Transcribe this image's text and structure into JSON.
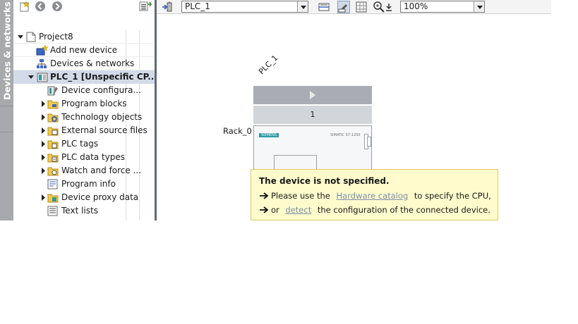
{
  "side_tab": {
    "label": "Devices & networks"
  },
  "project_tree": {
    "items": [
      {
        "label": "Project8",
        "icon": "project-icon",
        "expander": "open"
      },
      {
        "label": "Add new device",
        "icon": "add-device-icon",
        "expander": "none"
      },
      {
        "label": "Devices & networks",
        "icon": "network-icon",
        "expander": "none"
      },
      {
        "label": "PLC_1 [Unspecific CP...",
        "icon": "plc-icon",
        "expander": "open",
        "selected": true
      },
      {
        "label": "Device configura...",
        "icon": "device-config-icon",
        "expander": "none"
      },
      {
        "label": "Program blocks",
        "icon": "folder-icon",
        "expander": "closed"
      },
      {
        "label": "Technology objects",
        "icon": "technology-folder-icon",
        "expander": "closed"
      },
      {
        "label": "External source files",
        "icon": "source-folder-icon",
        "expander": "closed"
      },
      {
        "label": "PLC tags",
        "icon": "tags-folder-icon",
        "expander": "closed"
      },
      {
        "label": "PLC data types",
        "icon": "datatypes-folder-icon",
        "expander": "closed"
      },
      {
        "label": "Watch and force ...",
        "icon": "watch-folder-icon",
        "expander": "closed"
      },
      {
        "label": "Program info",
        "icon": "program-info-icon",
        "expander": "none"
      },
      {
        "label": "Device proxy data",
        "icon": "proxy-folder-icon",
        "expander": "closed"
      },
      {
        "label": "Text lists",
        "icon": "text-list-icon",
        "expander": "none"
      }
    ]
  },
  "device_toolbar": {
    "device_select": "PLC_1",
    "zoom_select": "100%"
  },
  "canvas": {
    "plc_name": "PLC_1",
    "rack_label": "Rack_0",
    "slot_number": "1",
    "cpu_brand": "SIEMENS",
    "cpu_model": "SIMATIC S7-1200"
  },
  "info_tip": {
    "title": "The device is not specified.",
    "line1_before": "Please use the",
    "line1_link": "Hardware catalog",
    "line1_after": "to specify the CPU,",
    "line2_before": "or",
    "line2_link": "detect",
    "line2_after": "the configuration of the connected device."
  },
  "colors": {
    "side_tab": "#a7a9ac",
    "splitter": "#5f6a76",
    "selection": "#d3dbe8",
    "tooltip_bg": "#fffbcc",
    "link": "#7a8ea6"
  }
}
